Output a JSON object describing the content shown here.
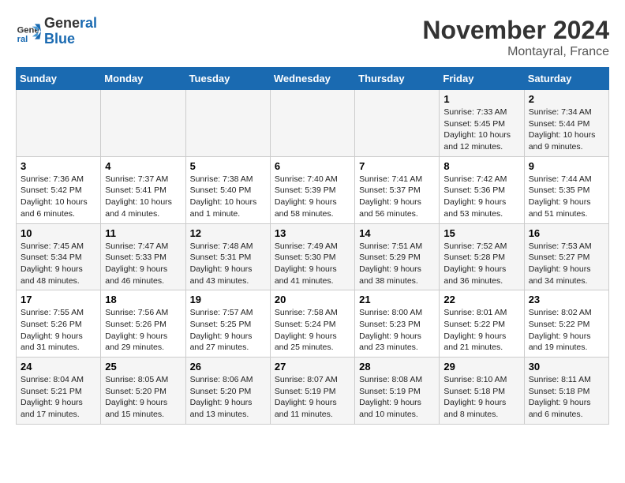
{
  "header": {
    "logo_line1": "General",
    "logo_line2": "Blue",
    "month_title": "November 2024",
    "location": "Montayral, France"
  },
  "days_of_week": [
    "Sunday",
    "Monday",
    "Tuesday",
    "Wednesday",
    "Thursday",
    "Friday",
    "Saturday"
  ],
  "weeks": [
    [
      {
        "day": "",
        "info": ""
      },
      {
        "day": "",
        "info": ""
      },
      {
        "day": "",
        "info": ""
      },
      {
        "day": "",
        "info": ""
      },
      {
        "day": "",
        "info": ""
      },
      {
        "day": "1",
        "info": "Sunrise: 7:33 AM\nSunset: 5:45 PM\nDaylight: 10 hours and 12 minutes."
      },
      {
        "day": "2",
        "info": "Sunrise: 7:34 AM\nSunset: 5:44 PM\nDaylight: 10 hours and 9 minutes."
      }
    ],
    [
      {
        "day": "3",
        "info": "Sunrise: 7:36 AM\nSunset: 5:42 PM\nDaylight: 10 hours and 6 minutes."
      },
      {
        "day": "4",
        "info": "Sunrise: 7:37 AM\nSunset: 5:41 PM\nDaylight: 10 hours and 4 minutes."
      },
      {
        "day": "5",
        "info": "Sunrise: 7:38 AM\nSunset: 5:40 PM\nDaylight: 10 hours and 1 minute."
      },
      {
        "day": "6",
        "info": "Sunrise: 7:40 AM\nSunset: 5:39 PM\nDaylight: 9 hours and 58 minutes."
      },
      {
        "day": "7",
        "info": "Sunrise: 7:41 AM\nSunset: 5:37 PM\nDaylight: 9 hours and 56 minutes."
      },
      {
        "day": "8",
        "info": "Sunrise: 7:42 AM\nSunset: 5:36 PM\nDaylight: 9 hours and 53 minutes."
      },
      {
        "day": "9",
        "info": "Sunrise: 7:44 AM\nSunset: 5:35 PM\nDaylight: 9 hours and 51 minutes."
      }
    ],
    [
      {
        "day": "10",
        "info": "Sunrise: 7:45 AM\nSunset: 5:34 PM\nDaylight: 9 hours and 48 minutes."
      },
      {
        "day": "11",
        "info": "Sunrise: 7:47 AM\nSunset: 5:33 PM\nDaylight: 9 hours and 46 minutes."
      },
      {
        "day": "12",
        "info": "Sunrise: 7:48 AM\nSunset: 5:31 PM\nDaylight: 9 hours and 43 minutes."
      },
      {
        "day": "13",
        "info": "Sunrise: 7:49 AM\nSunset: 5:30 PM\nDaylight: 9 hours and 41 minutes."
      },
      {
        "day": "14",
        "info": "Sunrise: 7:51 AM\nSunset: 5:29 PM\nDaylight: 9 hours and 38 minutes."
      },
      {
        "day": "15",
        "info": "Sunrise: 7:52 AM\nSunset: 5:28 PM\nDaylight: 9 hours and 36 minutes."
      },
      {
        "day": "16",
        "info": "Sunrise: 7:53 AM\nSunset: 5:27 PM\nDaylight: 9 hours and 34 minutes."
      }
    ],
    [
      {
        "day": "17",
        "info": "Sunrise: 7:55 AM\nSunset: 5:26 PM\nDaylight: 9 hours and 31 minutes."
      },
      {
        "day": "18",
        "info": "Sunrise: 7:56 AM\nSunset: 5:26 PM\nDaylight: 9 hours and 29 minutes."
      },
      {
        "day": "19",
        "info": "Sunrise: 7:57 AM\nSunset: 5:25 PM\nDaylight: 9 hours and 27 minutes."
      },
      {
        "day": "20",
        "info": "Sunrise: 7:58 AM\nSunset: 5:24 PM\nDaylight: 9 hours and 25 minutes."
      },
      {
        "day": "21",
        "info": "Sunrise: 8:00 AM\nSunset: 5:23 PM\nDaylight: 9 hours and 23 minutes."
      },
      {
        "day": "22",
        "info": "Sunrise: 8:01 AM\nSunset: 5:22 PM\nDaylight: 9 hours and 21 minutes."
      },
      {
        "day": "23",
        "info": "Sunrise: 8:02 AM\nSunset: 5:22 PM\nDaylight: 9 hours and 19 minutes."
      }
    ],
    [
      {
        "day": "24",
        "info": "Sunrise: 8:04 AM\nSunset: 5:21 PM\nDaylight: 9 hours and 17 minutes."
      },
      {
        "day": "25",
        "info": "Sunrise: 8:05 AM\nSunset: 5:20 PM\nDaylight: 9 hours and 15 minutes."
      },
      {
        "day": "26",
        "info": "Sunrise: 8:06 AM\nSunset: 5:20 PM\nDaylight: 9 hours and 13 minutes."
      },
      {
        "day": "27",
        "info": "Sunrise: 8:07 AM\nSunset: 5:19 PM\nDaylight: 9 hours and 11 minutes."
      },
      {
        "day": "28",
        "info": "Sunrise: 8:08 AM\nSunset: 5:19 PM\nDaylight: 9 hours and 10 minutes."
      },
      {
        "day": "29",
        "info": "Sunrise: 8:10 AM\nSunset: 5:18 PM\nDaylight: 9 hours and 8 minutes."
      },
      {
        "day": "30",
        "info": "Sunrise: 8:11 AM\nSunset: 5:18 PM\nDaylight: 9 hours and 6 minutes."
      }
    ]
  ]
}
